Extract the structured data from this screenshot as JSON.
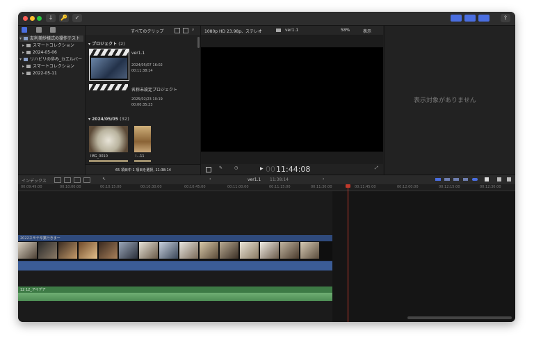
{
  "toolbar": {
    "buttons": [
      "↓",
      "🔑",
      "✓"
    ],
    "share": "⇪"
  },
  "library": {
    "items": [
      {
        "label": "友利美紗様式の操作テスト",
        "icon": "library-icon",
        "indent": 0,
        "expanded": true,
        "selected": true
      },
      {
        "label": "スマートコレクション",
        "icon": "folder-icon",
        "indent": 1,
        "expanded": false
      },
      {
        "label": "2024-05-06",
        "icon": "event-icon",
        "indent": 1,
        "expanded": false
      },
      {
        "label": "リハビリの歩み_カエルバー",
        "icon": "library-icon",
        "indent": 0,
        "expanded": true
      },
      {
        "label": "スマートコレクション",
        "icon": "folder-icon",
        "indent": 1,
        "expanded": false
      },
      {
        "label": "2022-05-11",
        "icon": "event-icon",
        "indent": 1,
        "expanded": false
      }
    ]
  },
  "browser": {
    "filter": "すべてのクリップ",
    "section_project": "プロジェクト",
    "section_project_count": "(2)",
    "projects": [
      {
        "name": "ver1.1",
        "date": "2024/05/07 16:02",
        "duration": "00:11:38:14"
      },
      {
        "name": "名称未設定プロジェクト",
        "date": "2025/02/23 10:19",
        "duration": "00:00:35:23"
      }
    ],
    "section_date": "2024/05/05",
    "section_date_count": "(32)",
    "clips": [
      {
        "name": "IMG_0010"
      },
      {
        "name": "I...11"
      }
    ],
    "status": "65 項目中 1 項目を選択, 11:38:14"
  },
  "viewer": {
    "format": "1080p HD 23.98p、ステレオ",
    "project": "ver1.1",
    "zoom": "58%",
    "view_menu": "表示",
    "timecode_dim": "00",
    "timecode": "11:44:08"
  },
  "inspector": {
    "empty_message": "表示対象がありません"
  },
  "timeline_bar": {
    "index_label": "インデックス",
    "project": "ver1.1",
    "duration": "11:38:14"
  },
  "ruler": {
    "ticks": [
      "00:09:49:00",
      "00:10:00:00",
      "00:10:15:00",
      "00:10:30:00",
      "00:10:45:00",
      "00:11:00:00",
      "00:11:15:00",
      "00:11:30:00",
      "00:11:45:00",
      "00:12:00:00",
      "00:12:15:00",
      "00:12:30:00"
    ]
  },
  "timeline": {
    "video_clip_name": "2022ネモテ卒業行きまー",
    "audio_clip_name": "12 12_アイデア"
  },
  "colors": {
    "accent": "#4a6ee0",
    "playhead": "#c0392b",
    "video_clip": "#2f4a7c",
    "audio_clip": "#3d7a45"
  }
}
